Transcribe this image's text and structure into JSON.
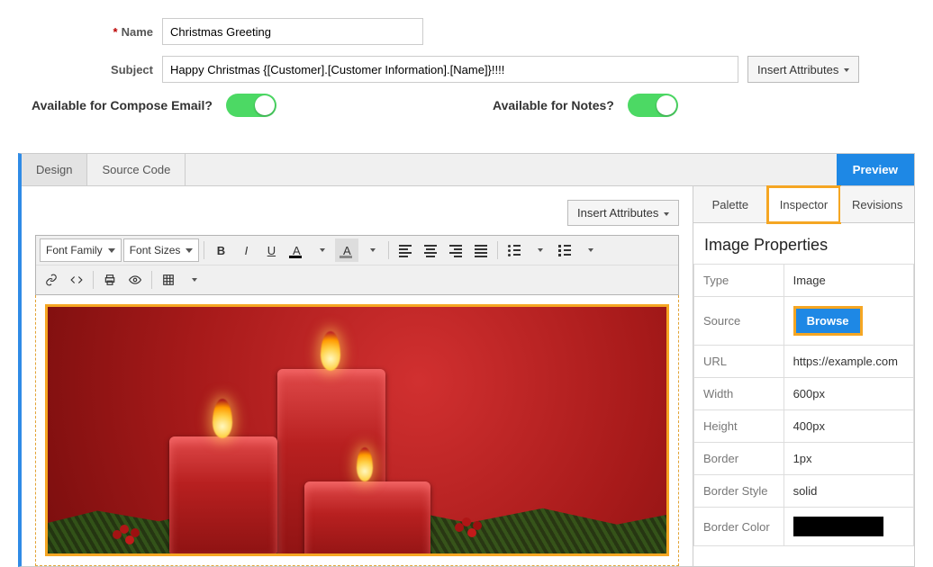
{
  "form": {
    "name_label": "Name",
    "name_value": "Christmas Greeting",
    "subject_label": "Subject",
    "subject_value": "Happy Christmas {[Customer].[Customer Information].[Name]}!!!!",
    "insert_attributes": "Insert Attributes"
  },
  "toggles": {
    "compose_label": "Available for Compose Email?",
    "notes_label": "Available for Notes?"
  },
  "editor": {
    "tabs": {
      "design": "Design",
      "source": "Source Code"
    },
    "preview": "Preview",
    "insert_attributes": "Insert Attributes",
    "toolbar": {
      "font_family": "Font Family",
      "font_sizes": "Font Sizes"
    }
  },
  "inspector": {
    "tabs": {
      "palette": "Palette",
      "inspector": "Inspector",
      "revisions": "Revisions"
    },
    "title": "Image Properties",
    "rows": {
      "type_label": "Type",
      "type_value": "Image",
      "source_label": "Source",
      "browse": "Browse",
      "url_label": "URL",
      "url_value": "https://example.com",
      "width_label": "Width",
      "width_value": "600px",
      "height_label": "Height",
      "height_value": "400px",
      "border_label": "Border",
      "border_value": "1px",
      "bstyle_label": "Border Style",
      "bstyle_value": "solid",
      "bcolor_label": "Border Color",
      "bcolor_value": "#000000"
    }
  }
}
